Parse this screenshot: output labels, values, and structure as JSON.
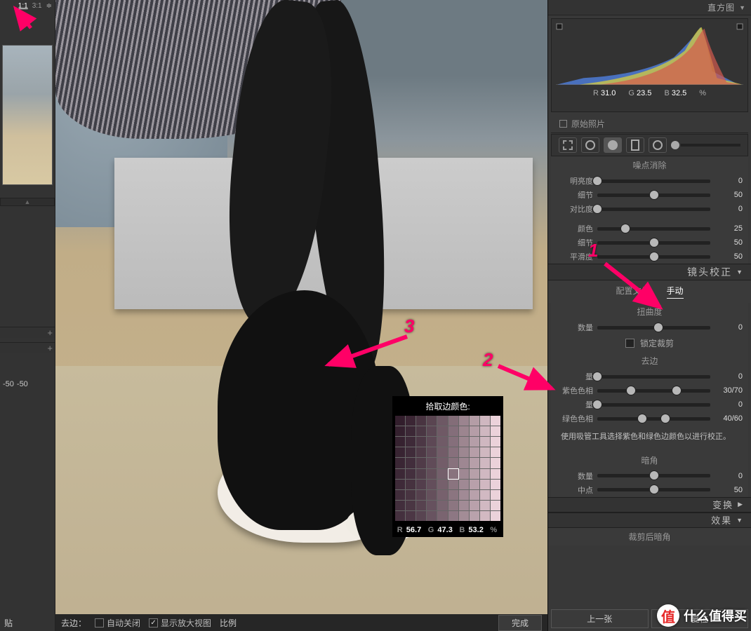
{
  "zoom": {
    "levels": [
      "1:1",
      "3:1"
    ],
    "selected": 0,
    "dropdown_icon": "≑"
  },
  "left": {
    "track_a": "-50",
    "track_b": "-50",
    "paste_label": "贴"
  },
  "histogram": {
    "panel_title": "直方图",
    "rgb": {
      "r_label": "R",
      "r": "31.0",
      "g_label": "G",
      "g": "23.5",
      "b_label": "B",
      "b": "32.5",
      "unit": "%"
    },
    "original_label": "原始照片"
  },
  "noise": {
    "title": "噪点消除",
    "rows": [
      {
        "label": "明亮度",
        "value": "0",
        "pos": 0
      },
      {
        "label": "细节",
        "value": "50",
        "pos": 50
      },
      {
        "label": "对比度",
        "value": "0",
        "pos": 0
      }
    ],
    "color_rows": [
      {
        "label": "颜色",
        "value": "25",
        "pos": 25
      },
      {
        "label": "细节",
        "value": "50",
        "pos": 50
      },
      {
        "label": "平滑度",
        "value": "50",
        "pos": 50
      }
    ]
  },
  "lens": {
    "panel_title": "镜头校正",
    "tabs": {
      "profile": "配置文件",
      "manual": "手动",
      "active": "manual"
    },
    "distortion": {
      "title": "扭曲度",
      "amount_label": "数量",
      "amount_value": "0",
      "pos": 50,
      "lock_label": "锁定裁剪"
    },
    "defringe": {
      "title": "去边",
      "rows": [
        {
          "label": "量",
          "value": "0",
          "class": "gradient-rainbow",
          "knobs": [
            0
          ]
        },
        {
          "label": "紫色色相",
          "value": "30/70",
          "class": "gradient-purple",
          "knobs": [
            30,
            70
          ]
        },
        {
          "label": "量",
          "value": "0",
          "class": "gradient-rainbow",
          "knobs": [
            0
          ]
        },
        {
          "label": "绿色色相",
          "value": "40/60",
          "class": "gradient-green",
          "knobs": [
            40,
            60
          ]
        }
      ],
      "hint": "使用吸管工具选择紫色和绿色边颜色以进行校正。"
    },
    "vignette": {
      "title": "暗角",
      "rows": [
        {
          "label": "数量",
          "value": "0",
          "pos": 50
        },
        {
          "label": "中点",
          "value": "50",
          "pos": 50
        }
      ]
    }
  },
  "collapsed_panels": {
    "transform": "变换",
    "effects": "效果",
    "post_crop": "裁剪后暗角"
  },
  "nav": {
    "prev": "上一张",
    "reset": "复位"
  },
  "sampler": {
    "title": "拾取边颜色:",
    "readout": {
      "r_label": "R",
      "r": "56.7",
      "g_label": "G",
      "g": "47.3",
      "b_label": "B",
      "b": "53.2",
      "unit": "%"
    }
  },
  "toolbar": {
    "defringe": "去边：",
    "auto_close": "自动关闭",
    "show_loupe": "显示放大视图",
    "ratio": "比例",
    "done": "完成"
  },
  "annotations": {
    "one": "1",
    "two": "2",
    "three": "3"
  },
  "watermark": {
    "badge": "值",
    "text": "什么值得买"
  }
}
